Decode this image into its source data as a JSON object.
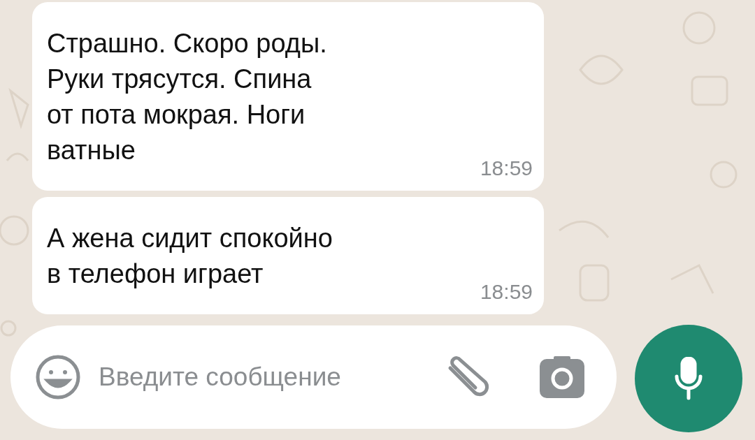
{
  "messages": [
    {
      "text": "Страшно. Скоро роды.\nРуки трясутся. Спина\nот пота мокрая. Ноги\nватные",
      "time": "18:59"
    },
    {
      "text": "А жена сидит спокойно\nв телефон играет",
      "time": "18:59"
    }
  ],
  "composer": {
    "placeholder": "Введите сообщение"
  }
}
